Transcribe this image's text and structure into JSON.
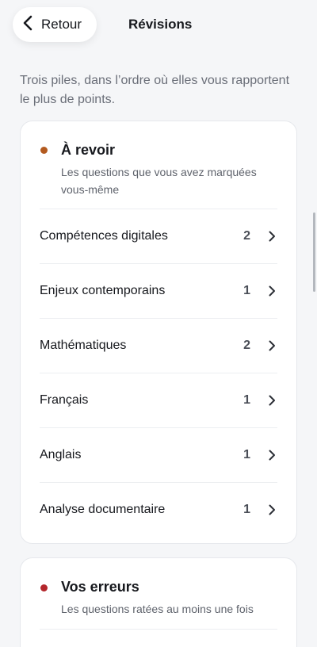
{
  "header": {
    "back_label": "Retour",
    "title": "Révisions"
  },
  "intro": "Trois piles, dans l’ordre où elles vous rapportent le plus de points.",
  "sections": [
    {
      "title": "À revoir",
      "subtitle": "Les questions que vous avez marquées vous-même",
      "dot_color": "#b35a1f",
      "items": [
        {
          "label": "Compétences digitales",
          "count": "2"
        },
        {
          "label": "Enjeux contemporains",
          "count": "1"
        },
        {
          "label": "Mathématiques",
          "count": "2"
        },
        {
          "label": "Français",
          "count": "1"
        },
        {
          "label": "Anglais",
          "count": "1"
        },
        {
          "label": "Analyse documentaire",
          "count": "1"
        }
      ]
    },
    {
      "title": "Vos erreurs",
      "subtitle": "Les questions ratées au moins une fois",
      "dot_color": "#b3262b",
      "items": []
    }
  ],
  "icons": {
    "back": "chevron-left-icon",
    "row": "chevron-right-icon"
  },
  "colors": {
    "background": "#f5f6f8",
    "card": "#ffffff",
    "text": "#16181d",
    "muted": "#6a6e78"
  }
}
